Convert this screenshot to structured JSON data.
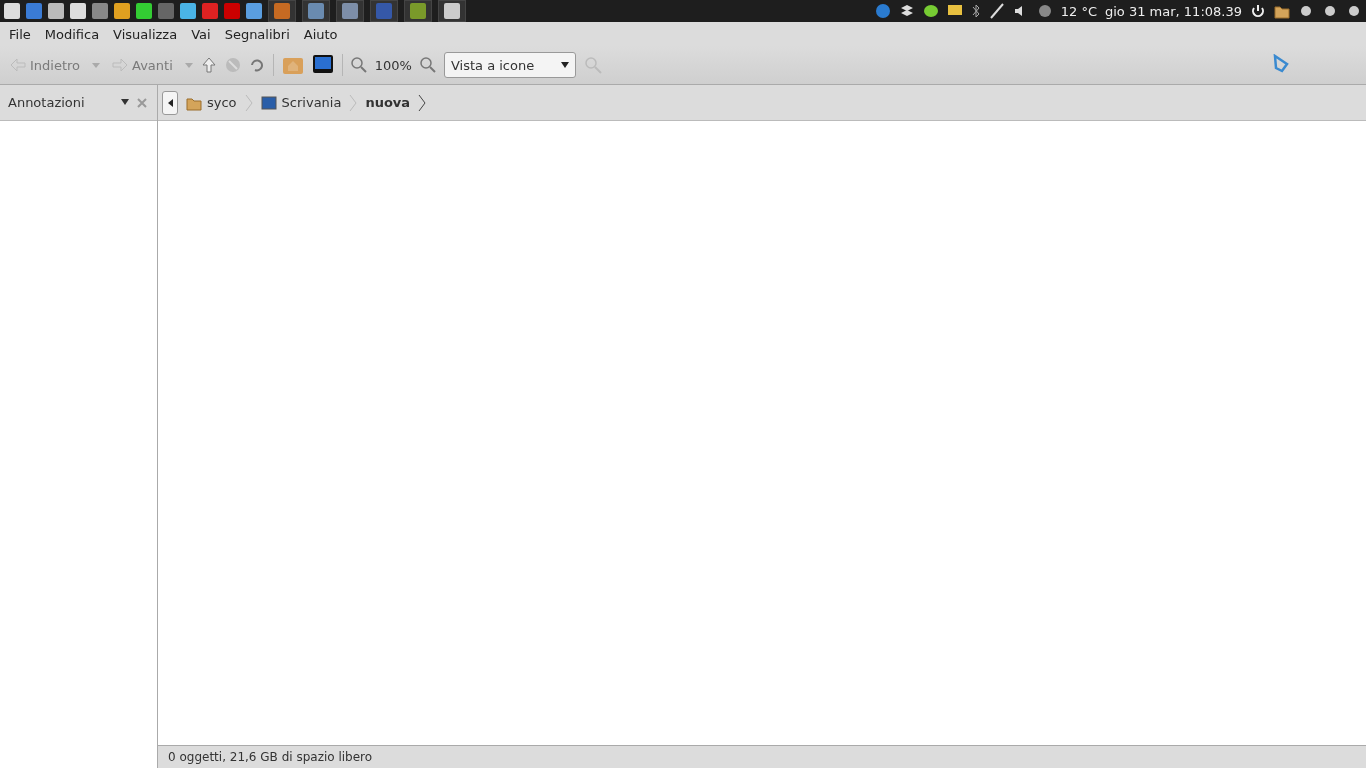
{
  "top_panel": {
    "temperature": "12 °C",
    "clock": "gio 31 mar, 11:08.39"
  },
  "menu": [
    "File",
    "Modifica",
    "Visualizza",
    "Vai",
    "Segnalibri",
    "Aiuto"
  ],
  "toolbar": {
    "back": {
      "label": "Indietro",
      "disabled": true
    },
    "forward": {
      "label": "Avanti",
      "disabled": true
    },
    "zoom": "100%",
    "view_mode": "Vista a icone"
  },
  "sidebar": {
    "title": "Annotazioni"
  },
  "breadcrumb": [
    {
      "label": "syco",
      "kind": "home",
      "selected": false
    },
    {
      "label": "Scrivania",
      "kind": "desktop",
      "selected": false
    },
    {
      "label": "nuova",
      "kind": "folder",
      "selected": true
    }
  ],
  "status_bar": "0 oggetti, 21,6 GB di spazio libero"
}
